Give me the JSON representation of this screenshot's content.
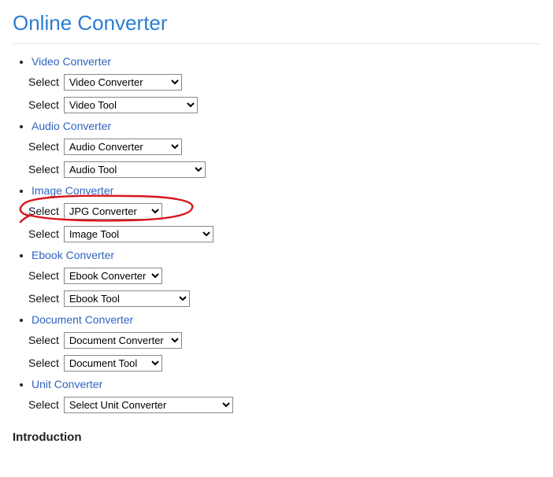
{
  "page_title": "Online Converter",
  "select_label": "Select",
  "intro_heading": "Introduction",
  "sections": {
    "video": {
      "link": "Video Converter",
      "conv": "Video Converter",
      "tool": "Video Tool"
    },
    "audio": {
      "link": "Audio Converter",
      "conv": "Audio Converter",
      "tool": "Audio Tool"
    },
    "image": {
      "link": "Image Converter",
      "conv": "JPG Converter",
      "tool": "Image Tool"
    },
    "ebook": {
      "link": "Ebook Converter",
      "conv": "Ebook Converter",
      "tool": "Ebook Tool"
    },
    "document": {
      "link": "Document Converter",
      "conv": "Document Converter",
      "tool": "Document Tool"
    },
    "unit": {
      "link": "Unit Converter",
      "conv": "Select Unit Converter"
    }
  },
  "annotation": {
    "color": "#d8151c"
  }
}
